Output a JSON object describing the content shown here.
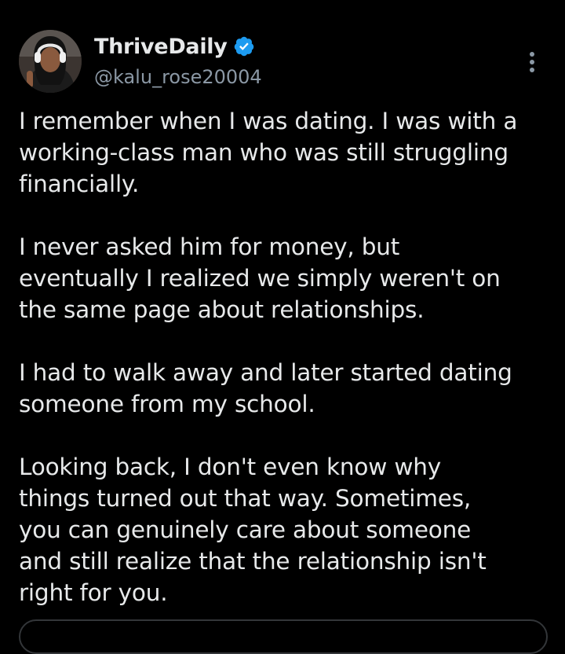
{
  "post": {
    "author": {
      "display_name": "ThriveDaily",
      "handle": "@kalu_rose20004",
      "verified": true,
      "avatar_icon": "profile-photo"
    },
    "more_icon": "vertical-ellipsis-icon",
    "paragraphs": [
      "I remember when I was dating. I was with a\nworking-class man who was still struggling\nfinancially.",
      "I never asked him for money, but\neventually I realized we simply weren't on\nthe same page about relationships.",
      "I had to walk away and later started dating\nsomeone from my school.",
      "Looking back, I don't even know why\nthings turned out that way. Sometimes,\nyou can genuinely care about someone\nand still realize that the relationship isn't\nright for you."
    ]
  },
  "colors": {
    "background": "#000000",
    "text": "#e7e9ea",
    "secondary_text": "#8b98a5",
    "verified_badge": "#1d9bf0",
    "border": "#333639"
  }
}
